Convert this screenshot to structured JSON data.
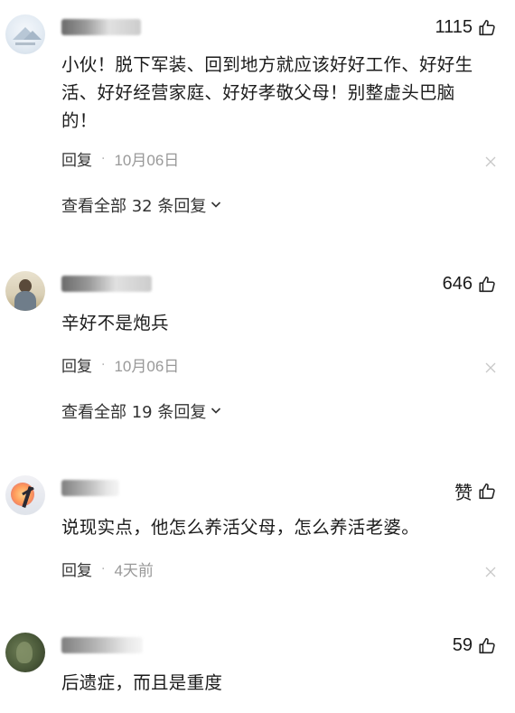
{
  "comments": [
    {
      "likes": "1115",
      "content": "小伙！脱下军装、回到地方就应该好好工作、好好生活、好好经营家庭、好好孝敬父母！别整虚头巴脑的！",
      "reply_label": "回复",
      "separator": "·",
      "date": "10月06日",
      "view_all": "查看全部 32 条回复"
    },
    {
      "likes": "646",
      "content": "辛好不是炮兵",
      "reply_label": "回复",
      "separator": "·",
      "date": "10月06日",
      "view_all": "查看全部 19 条回复"
    },
    {
      "likes": "赞",
      "content": "说现实点，他怎么养活父母，怎么养活老婆。",
      "reply_label": "回复",
      "separator": "·",
      "date": "4天前"
    },
    {
      "likes": "59",
      "content": "后遗症，而且是重度"
    }
  ]
}
